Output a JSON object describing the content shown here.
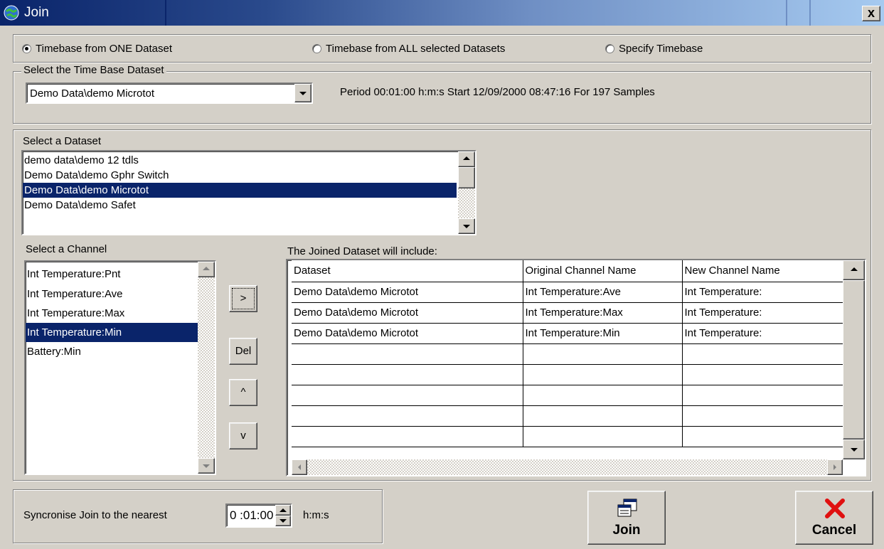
{
  "window": {
    "title": "Join",
    "close_label": "x"
  },
  "timebase": {
    "options": [
      {
        "label": "Timebase from ONE Dataset",
        "selected": true
      },
      {
        "label": "Timebase from ALL selected Datasets",
        "selected": false
      },
      {
        "label": "Specify Timebase",
        "selected": false
      }
    ]
  },
  "timebase_dataset": {
    "legend": "Select the Time Base  Dataset",
    "selected": "Demo Data\\demo Microtot",
    "info": "Period 00:01:00 h:m:s   Start 12/09/2000 08:47:16   For 197 Samples"
  },
  "dataset_list": {
    "label": "Select a Dataset",
    "items": [
      "demo data\\demo 12 tdls",
      "Demo Data\\demo Gphr Switch",
      "Demo Data\\demo Microtot",
      "Demo Data\\demo Safet"
    ],
    "selected_index": 2
  },
  "channel_list": {
    "label": "Select a Channel",
    "items": [
      "Int Temperature:Pnt",
      "Int Temperature:Ave",
      "Int Temperature:Max",
      "Int Temperature:Min",
      "Battery:Min"
    ],
    "selected_index": 3
  },
  "actions": {
    "add": ">",
    "delete": "Del",
    "up": "^",
    "down": "v"
  },
  "joined": {
    "label": "The Joined Dataset will include:",
    "columns": [
      "Dataset",
      "Original Channel Name",
      "New Channel Name"
    ],
    "rows": [
      [
        "Demo Data\\demo Microtot",
        "Int Temperature:Ave",
        "Int Temperature:"
      ],
      [
        "Demo Data\\demo Microtot",
        "Int Temperature:Max",
        "Int Temperature:"
      ],
      [
        "Demo Data\\demo Microtot",
        "Int Temperature:Min",
        "Int Temperature:"
      ],
      [
        "",
        "",
        ""
      ],
      [
        "",
        "",
        ""
      ],
      [
        "",
        "",
        ""
      ],
      [
        "",
        "",
        ""
      ],
      [
        "",
        "",
        ""
      ]
    ]
  },
  "sync": {
    "label": "Syncronise Join to the nearest",
    "value": "0 :01:00",
    "unit": "h:m:s"
  },
  "buttons": {
    "join": "Join",
    "cancel": "Cancel"
  },
  "colors": {
    "selection": "#0a246a",
    "cancel_icon": "#e01010",
    "face": "#d4d0c8"
  }
}
